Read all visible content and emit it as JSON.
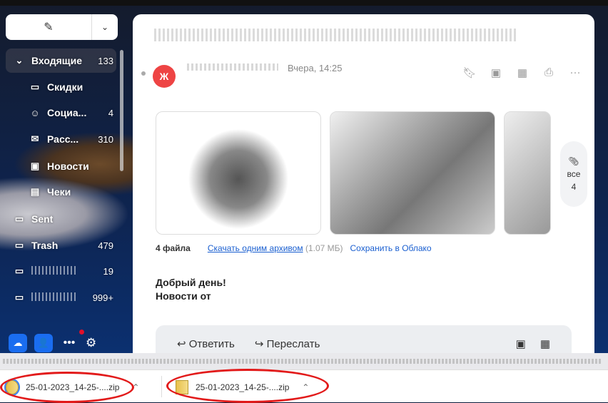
{
  "compose": {
    "icon": "pencil-icon",
    "dropdown_icon": "chevron-down-icon"
  },
  "sidebar": {
    "items": [
      {
        "label": "Входящие",
        "count": "133",
        "icon": "chevron-down-icon",
        "glyph": "⌄"
      },
      {
        "label": "Скидки",
        "count": "",
        "icon": "folder-icon",
        "glyph": "▭"
      },
      {
        "label": "Социа...",
        "count": "4",
        "icon": "people-icon",
        "glyph": "☺"
      },
      {
        "label": "Расс...",
        "count": "310",
        "icon": "newsletter-icon",
        "glyph": "✉"
      },
      {
        "label": "Новости",
        "count": "",
        "icon": "news-icon",
        "glyph": "▣"
      },
      {
        "label": "Чеки",
        "count": "",
        "icon": "receipt-icon",
        "glyph": "▤"
      },
      {
        "label": "Sent",
        "count": "",
        "icon": "folder-icon",
        "glyph": "▭"
      },
      {
        "label": "Trash",
        "count": "479",
        "icon": "folder-icon",
        "glyph": "▭"
      },
      {
        "label": "",
        "count": "19",
        "icon": "folder-icon",
        "glyph": "▭"
      },
      {
        "label": "",
        "count": "999+",
        "icon": "folder-icon",
        "glyph": "▭"
      }
    ]
  },
  "message": {
    "avatar_letter": "Ж",
    "date": "Вчера, 14:25",
    "avatar_color": "#ee4444",
    "tools": [
      "bookmark-icon",
      "video-icon",
      "calendar-icon",
      "print-icon",
      "more-icon"
    ],
    "files_count": "4 файла",
    "download_link": "Скачать одним архивом",
    "size": "(1.07 МБ)",
    "save_link": "Сохранить в Облако",
    "all_label": "все",
    "all_count": "4",
    "greeting": "Добрый день!",
    "news_from": "Новости от",
    "reply": "Ответить",
    "forward": "Переслать"
  },
  "downloads": [
    {
      "name": "25-01-2023_14-25-....zip"
    },
    {
      "name": "25-01-2023_14-25-....zip"
    }
  ]
}
